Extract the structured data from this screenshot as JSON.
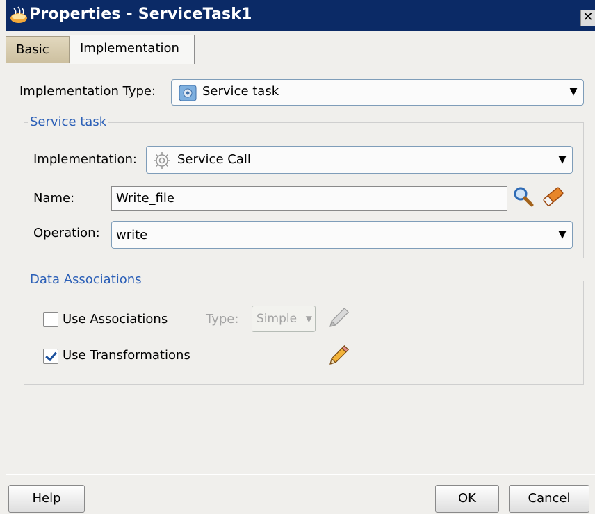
{
  "window": {
    "title": "Properties - ServiceTask1",
    "close_label": "✕"
  },
  "tabs": [
    {
      "label": "Basic",
      "selected": false
    },
    {
      "label": "Implementation",
      "selected": true
    }
  ],
  "implementation_type": {
    "label": "Implementation Type:",
    "value": "Service task",
    "icon": "service-task-icon"
  },
  "service_task_group": {
    "legend": "Service task",
    "implementation": {
      "label": "Implementation:",
      "value": "Service Call",
      "icon": "gear-icon"
    },
    "name": {
      "label": "Name:",
      "value": "Write_file",
      "search_icon": "search-icon",
      "clear_icon": "eraser-icon"
    },
    "operation": {
      "label": "Operation:",
      "value": "write"
    }
  },
  "data_associations": {
    "legend": "Data Associations",
    "use_associations": {
      "label": "Use Associations",
      "checked": false
    },
    "type_label": "Type:",
    "type_value": "Simple",
    "use_transformations": {
      "label": "Use Transformations",
      "checked": true
    }
  },
  "buttons": {
    "help": "Help",
    "ok": "OK",
    "cancel": "Cancel"
  },
  "colors": {
    "titlebar": "#0b2a66",
    "legend": "#2b5fb7",
    "background": "#f0efec"
  }
}
